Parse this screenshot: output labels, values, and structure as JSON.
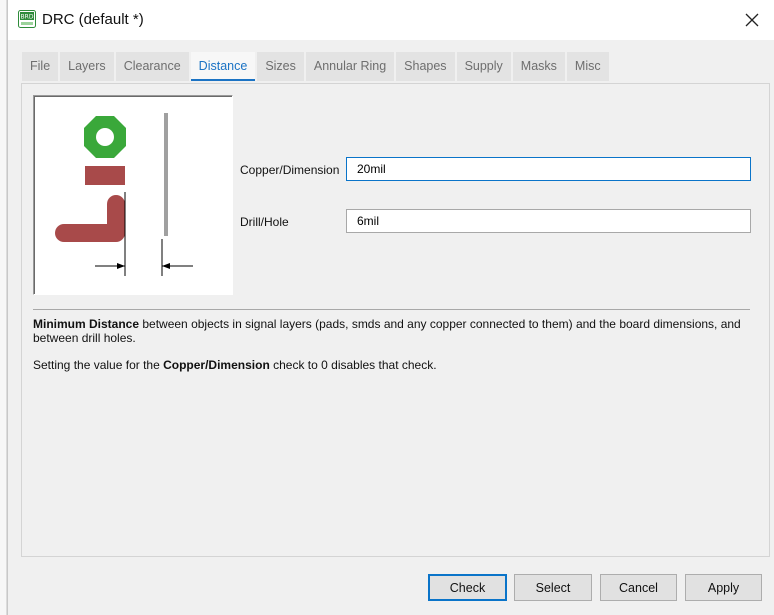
{
  "window": {
    "title": "DRC (default *)",
    "icon": "brd-board-icon",
    "icon_text": "BRD"
  },
  "tabs": [
    {
      "label": "File",
      "active": false
    },
    {
      "label": "Layers",
      "active": false
    },
    {
      "label": "Clearance",
      "active": false
    },
    {
      "label": "Distance",
      "active": true
    },
    {
      "label": "Sizes",
      "active": false
    },
    {
      "label": "Annular Ring",
      "active": false
    },
    {
      "label": "Shapes",
      "active": false
    },
    {
      "label": "Supply",
      "active": false
    },
    {
      "label": "Masks",
      "active": false
    },
    {
      "label": "Misc",
      "active": false
    }
  ],
  "fields": {
    "copper_dimension": {
      "label": "Copper/Dimension",
      "value": "20mil"
    },
    "drill_hole": {
      "label": "Drill/Hole",
      "value": "6mil"
    }
  },
  "description": {
    "p1_bold": "Minimum Distance",
    "p1_text": " between objects in signal layers (pads, smds and any copper connected to them) and the board dimensions, and between drill holes.",
    "p2_prefix": "Setting the value for the ",
    "p2_bold": "Copper/Dimension",
    "p2_suffix": " check to 0 disables that check."
  },
  "buttons": {
    "check": "Check",
    "select": "Select",
    "cancel": "Cancel",
    "apply": "Apply"
  },
  "colors": {
    "accent": "#1b73c4",
    "copper": "#a84a4a",
    "pad": "#3aa83a",
    "dimension": "#a0a0a0"
  }
}
